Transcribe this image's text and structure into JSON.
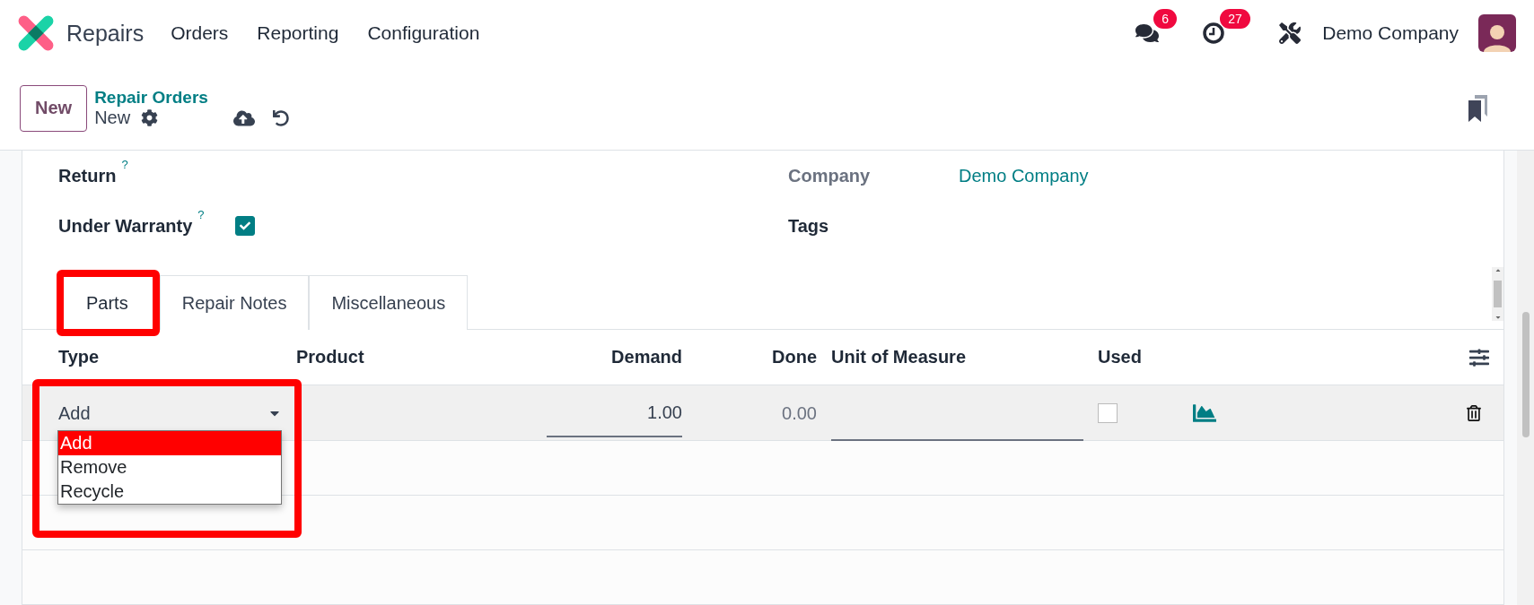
{
  "navbar": {
    "app_name": "Repairs",
    "menu": [
      "Orders",
      "Reporting",
      "Configuration"
    ],
    "messages_badge": "6",
    "activities_badge": "27",
    "company": "Demo Company"
  },
  "control_panel": {
    "new_button": "New",
    "breadcrumb": "Repair Orders",
    "record": "New"
  },
  "form": {
    "left_fields": [
      {
        "label": "Return",
        "help": "?",
        "kind": "text"
      },
      {
        "label": "Under Warranty",
        "help": "?",
        "kind": "checkbox",
        "checked": true
      }
    ],
    "right_fields": [
      {
        "label": "Company",
        "value": "Demo Company",
        "readonly": true
      },
      {
        "label": "Tags",
        "readonly": false
      }
    ]
  },
  "tabs": [
    {
      "label": "Parts",
      "selected": true,
      "highlighted": true
    },
    {
      "label": "Repair Notes",
      "selected": false,
      "highlighted": false
    },
    {
      "label": "Miscellaneous",
      "selected": false,
      "highlighted": false
    }
  ],
  "table": {
    "columns": [
      "Type",
      "Product",
      "Demand",
      "Done",
      "Unit of Measure",
      "Used"
    ],
    "rows": [
      {
        "type": "Add",
        "demand": "1.00",
        "done": "0.00",
        "used": false,
        "type_highlighted": true,
        "type_options": [
          {
            "label": "Add",
            "selected": true
          },
          {
            "label": "Remove",
            "selected": false
          },
          {
            "label": "Recycle",
            "selected": false
          }
        ]
      }
    ]
  }
}
